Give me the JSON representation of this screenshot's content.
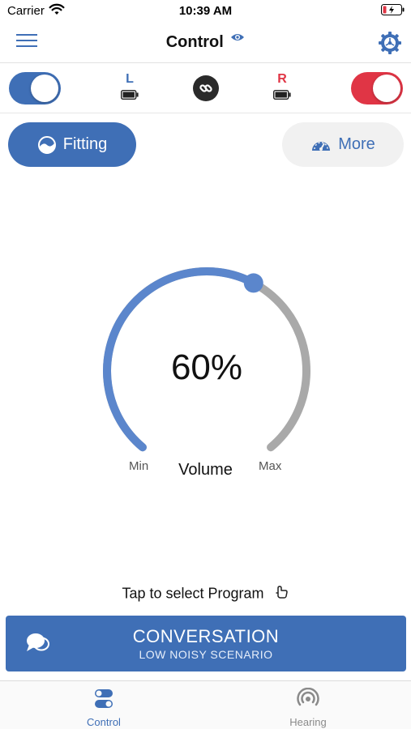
{
  "status_bar": {
    "carrier": "Carrier",
    "time": "10:39 AM"
  },
  "nav": {
    "title": "Control",
    "icons": [
      "menu-icon",
      "eye-icon",
      "gear-icon"
    ]
  },
  "devices": {
    "left": {
      "label": "L",
      "enabled": true,
      "color": "#3f6fb6"
    },
    "right": {
      "label": "R",
      "enabled": true,
      "color": "#e03545"
    },
    "link_icon": "link-icon"
  },
  "modes": {
    "fitting_label": "Fitting",
    "more_label": "More"
  },
  "volume": {
    "value_text": "60%",
    "value": 60,
    "label": "Volume",
    "min_label": "Min",
    "max_label": "Max"
  },
  "program": {
    "prompt": "Tap to select Program",
    "name": "CONVERSATION",
    "scenario": "LOW NOISY SCENARIO"
  },
  "tabs": [
    {
      "label": "Control",
      "active": true
    },
    {
      "label": "Hearing",
      "active": false
    }
  ],
  "colors": {
    "accent": "#3f6fb6",
    "right_accent": "#e03545",
    "track_inactive": "#a9a9a9",
    "dial_active": "#5b86cc"
  }
}
